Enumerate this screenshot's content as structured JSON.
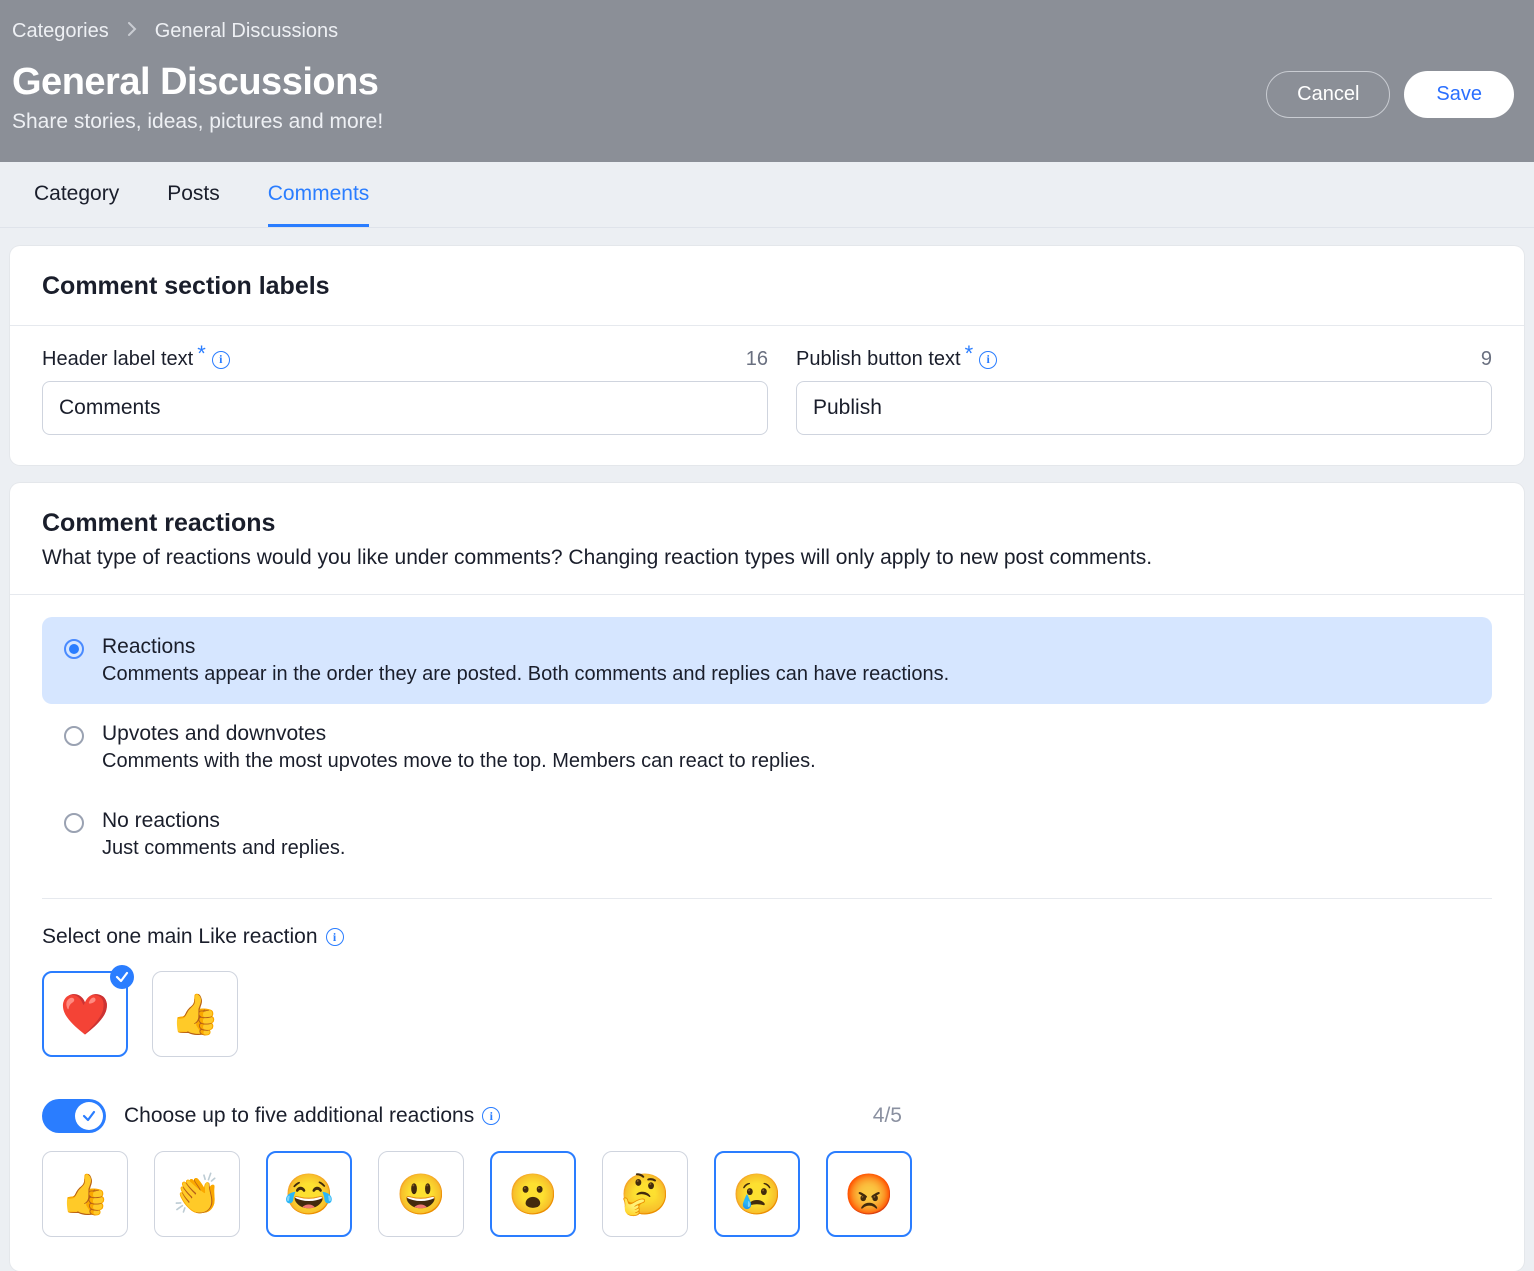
{
  "breadcrumb": {
    "root": "Categories",
    "current": "General Discussions"
  },
  "page": {
    "title": "General Discussions",
    "subtitle": "Share stories, ideas, pictures and more!",
    "cancel": "Cancel",
    "save": "Save"
  },
  "tabs": {
    "category": "Category",
    "posts": "Posts",
    "comments": "Comments"
  },
  "section_labels": {
    "title": "Comment section labels",
    "header_field": {
      "label": "Header label text",
      "value": "Comments",
      "count": "16"
    },
    "publish_field": {
      "label": "Publish button text",
      "value": "Publish",
      "count": "9"
    }
  },
  "reactions": {
    "title": "Comment reactions",
    "subtitle": "What type of reactions would you like under comments? Changing reaction types will only apply to new post comments.",
    "options": [
      {
        "title": "Reactions",
        "desc": "Comments appear in the order they are posted. Both comments and replies can have reactions.",
        "selected": true
      },
      {
        "title": "Upvotes and downvotes",
        "desc": "Comments with the most upvotes move to the top. Members can react to replies.",
        "selected": false
      },
      {
        "title": "No reactions",
        "desc": "Just comments and replies.",
        "selected": false
      }
    ],
    "main_like_label": "Select one main Like reaction",
    "main_like": [
      {
        "emoji": "❤️",
        "name": "heart",
        "selected": true
      },
      {
        "emoji": "👍",
        "name": "thumbs-up",
        "selected": false
      }
    ],
    "additional": {
      "label": "Choose up to five additional reactions",
      "count": "4/5",
      "items": [
        {
          "emoji": "👍",
          "name": "thumbs-up",
          "selected": false
        },
        {
          "emoji": "👏",
          "name": "clap",
          "selected": false
        },
        {
          "emoji": "😂",
          "name": "laugh",
          "selected": true
        },
        {
          "emoji": "😃",
          "name": "smile",
          "selected": false
        },
        {
          "emoji": "😮",
          "name": "wow",
          "selected": true
        },
        {
          "emoji": "🤔",
          "name": "thinking",
          "selected": false
        },
        {
          "emoji": "😢",
          "name": "sad",
          "selected": true
        },
        {
          "emoji": "😡",
          "name": "angry",
          "selected": true
        }
      ]
    }
  }
}
